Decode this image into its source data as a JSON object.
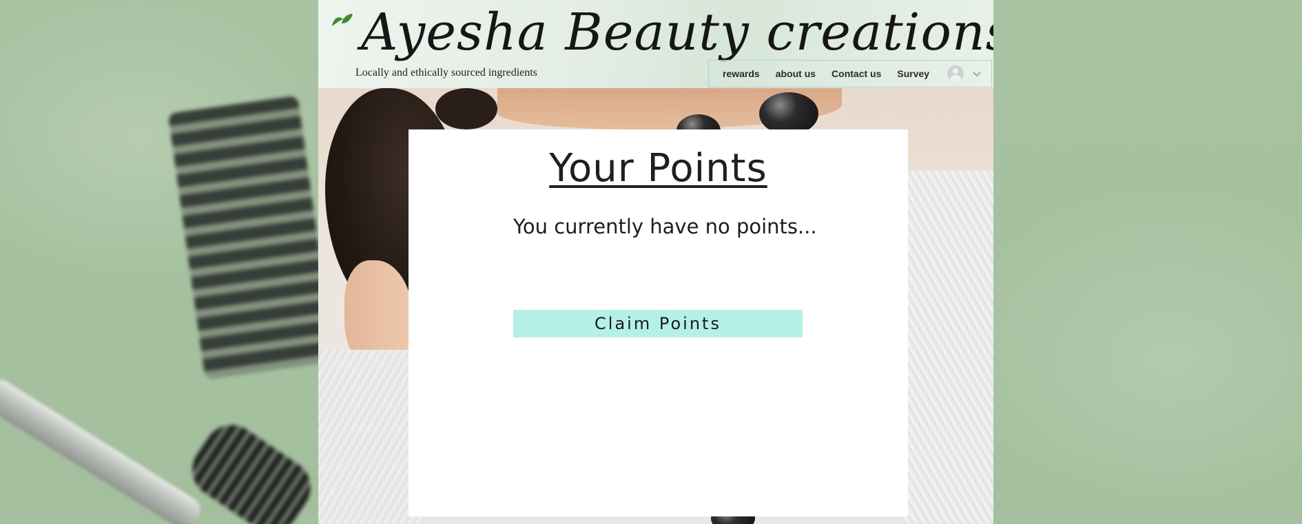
{
  "header": {
    "site_title": "Ayesha Beauty creations",
    "tagline": "Locally and ethically sourced ingredients"
  },
  "nav": {
    "items": [
      {
        "label": "rewards"
      },
      {
        "label": "about us"
      },
      {
        "label": "Contact us"
      },
      {
        "label": "Survey"
      }
    ],
    "account_icon": "user-avatar-icon",
    "dropdown_icon": "chevron-down-icon"
  },
  "main": {
    "title": "Your Points",
    "status": "You currently have no points...",
    "claim_button_label": "Claim Points"
  },
  "colors": {
    "accent_button": "#b5f0e6",
    "leaf_green": "#3f8a2e",
    "nav_border": "#a9d6cb"
  }
}
